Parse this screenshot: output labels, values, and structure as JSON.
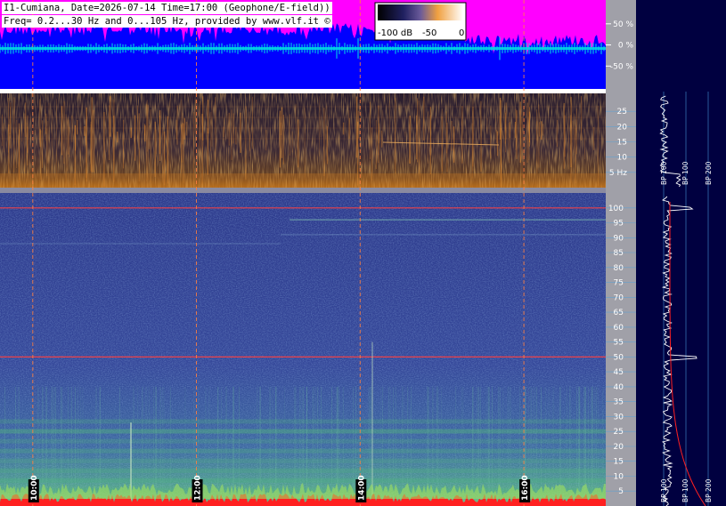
{
  "header": {
    "line1": "I1-Cumiana, Date=2026-07-14 Time=17:00 (Geophone/E-field))",
    "line2": "Freq= 0.2...30 Hz and 0...105 Hz, provided by www.vlf.it ©"
  },
  "colorbar": {
    "labels": [
      "-100 dB",
      "-50",
      "0"
    ]
  },
  "chart_data": [
    {
      "type": "line",
      "panel": "waveform",
      "y_ticks": [
        "50 %",
        "0 %",
        "-50 %"
      ],
      "y_tick_values": [
        50,
        0,
        -50
      ],
      "ylim": [
        -100,
        100
      ],
      "colors": {
        "background": "#0000ff",
        "envelope": "#ff00ff",
        "signal": "#00e5e5"
      }
    },
    {
      "type": "heatmap",
      "panel": "low-frequency spectrogram",
      "y_ticks": [
        "25",
        "20",
        "15",
        "10",
        "5 Hz"
      ],
      "y_tick_values": [
        25,
        20,
        15,
        10,
        5
      ],
      "ylim": [
        0,
        30
      ],
      "colormap": "dark-blue-orange"
    },
    {
      "type": "heatmap",
      "panel": "high-frequency spectrogram",
      "y_ticks": [
        "100",
        "95",
        "90",
        "85",
        "80",
        "75",
        "70",
        "65",
        "60",
        "55",
        "50",
        "45",
        "40",
        "35",
        "30",
        "25",
        "20",
        "15",
        "10",
        "5"
      ],
      "y_tick_values": [
        100,
        95,
        90,
        85,
        80,
        75,
        70,
        65,
        60,
        55,
        50,
        45,
        40,
        35,
        30,
        25,
        20,
        15,
        10,
        5
      ],
      "ylim": [
        0,
        105
      ],
      "x_ticks": [
        "10:00",
        "12:00",
        "14:00",
        "16:00"
      ],
      "xlim_hours": [
        9.6,
        17.0
      ],
      "tick_hours": [
        10,
        12,
        14,
        16
      ],
      "lines_hz": [
        50,
        100
      ],
      "colormap": "blue-green-red"
    },
    {
      "type": "line",
      "panel": "side spectrum",
      "labels_top": [
        "BP 100",
        "BP 100",
        "BP 200"
      ],
      "labels_bottom": [
        "BP 100",
        "BP 100",
        "BP 200"
      ],
      "peaks_hz": [
        50,
        100
      ],
      "colors": {
        "spectrum": "#ffffff",
        "average": "#ff2020"
      }
    }
  ]
}
